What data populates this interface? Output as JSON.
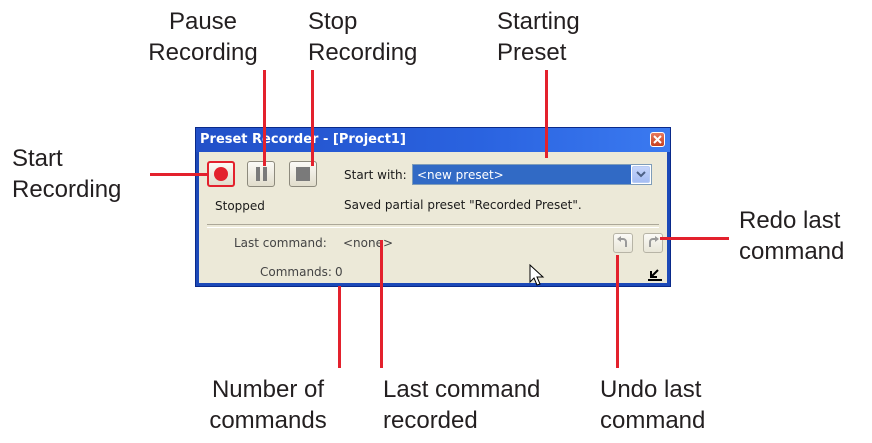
{
  "callouts": {
    "pause": [
      "Pause",
      "Recording"
    ],
    "stop": [
      "Stop",
      "Recording"
    ],
    "starting_preset": [
      "Starting",
      "Preset"
    ],
    "start": [
      "Start",
      "Recording"
    ],
    "redo": [
      "Redo last",
      "command"
    ],
    "number_commands": [
      "Number of",
      "commands"
    ],
    "last_command": [
      "Last command",
      "recorded"
    ],
    "undo": [
      "Undo last",
      "command"
    ]
  },
  "window": {
    "title": "Preset Recorder - [Project1]",
    "status": "Stopped",
    "start_with_label": "Start with:",
    "start_with_value": "<new preset>",
    "message": "Saved partial preset \"Recorded Preset\".",
    "last_command_label": "Last command:",
    "last_command_value": "<none>",
    "commands_label": "Commands:",
    "commands_value": "0"
  },
  "colors": {
    "callout_line": "#e3212d",
    "record_dot": "#e3212d",
    "title_bar": "#2a63e0",
    "selection": "#316ac5"
  },
  "icons": {
    "record": "record-icon",
    "pause": "pause-icon",
    "stop": "stop-icon",
    "dropdown": "chevron-down-icon",
    "undo": "undo-icon",
    "redo": "redo-icon",
    "resize": "resize-icon",
    "close": "close-icon",
    "cursor": "mouse-cursor-icon"
  }
}
